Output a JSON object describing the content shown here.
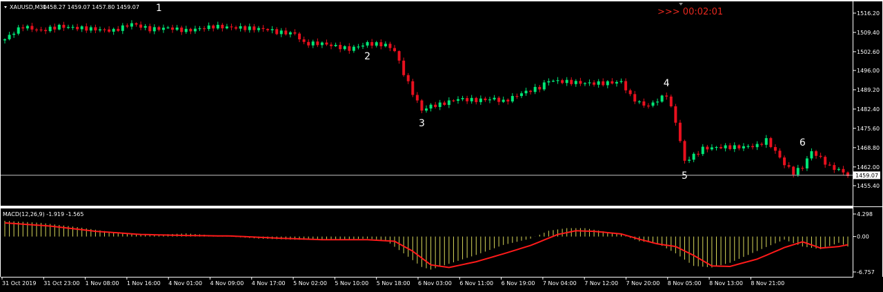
{
  "header": {
    "symbol": "XAUUSD,M30",
    "ohlc": "1458.27 1459.07 1457.80 1459.07",
    "timer": ">>> 00:02:01"
  },
  "price_axis": {
    "ticks": [
      "1516.20",
      "1509.40",
      "1502.60",
      "1496.00",
      "1489.20",
      "1482.40",
      "1475.60",
      "1468.80",
      "1462.00",
      "1455.40"
    ],
    "current_price": "1459.07"
  },
  "macd": {
    "label": "MACD(12,26,9) -1.919 -1.565",
    "ticks": [
      "4.298",
      "0.00",
      "-6.757"
    ]
  },
  "time_axis": {
    "labels": [
      "31 Oct 2019",
      "31 Oct 23:00",
      "1 Nov 08:00",
      "1 Nov 16:00",
      "4 Nov 01:00",
      "4 Nov 09:00",
      "4 Nov 17:00",
      "5 Nov 02:00",
      "5 Nov 10:00",
      "5 Nov 18:00",
      "6 Nov 03:00",
      "6 Nov 11:00",
      "6 Nov 19:00",
      "7 Nov 04:00",
      "7 Nov 12:00",
      "7 Nov 20:00",
      "8 Nov 05:00",
      "8 Nov 13:00",
      "8 Nov 21:00"
    ]
  },
  "annotations": [
    "1",
    "2",
    "3",
    "4",
    "5",
    "6"
  ],
  "colors": {
    "background": "#000000",
    "bull": "#00e676",
    "bear": "#e8101e",
    "text": "#ffffff",
    "macd_hist": "#d8d85a",
    "macd_signal": "#ff1a1a",
    "timer": "#e8281e",
    "grid_line": "#b0b0b0"
  },
  "chart_data": {
    "type": "candlestick",
    "symbol": "XAUUSD",
    "timeframe": "M30",
    "price_range": [
      1455.4,
      1516.2
    ],
    "price_path": [
      [
        0,
        1507.0
      ],
      [
        2,
        1509.5
      ],
      [
        4,
        1511.5
      ],
      [
        8,
        1510.0
      ],
      [
        12,
        1511.5
      ],
      [
        16,
        1511.0
      ],
      [
        20,
        1510.5
      ],
      [
        24,
        1510.0
      ],
      [
        28,
        1512.5
      ],
      [
        32,
        1510.5
      ],
      [
        36,
        1511.0
      ],
      [
        40,
        1510.0
      ],
      [
        46,
        1511.5
      ],
      [
        52,
        1511.0
      ],
      [
        58,
        1510.5
      ],
      [
        60,
        1509.5
      ],
      [
        64,
        1509.0
      ],
      [
        66,
        1505.5
      ],
      [
        70,
        1505.5
      ],
      [
        76,
        1503.5
      ],
      [
        80,
        1505.5
      ],
      [
        84,
        1505.0
      ],
      [
        86,
        1503.0
      ],
      [
        88,
        1495.0
      ],
      [
        90,
        1488.0
      ],
      [
        92,
        1482.0
      ],
      [
        94,
        1483.5
      ],
      [
        96,
        1484.0
      ],
      [
        100,
        1486.0
      ],
      [
        104,
        1485.5
      ],
      [
        108,
        1486.0
      ],
      [
        110,
        1485.0
      ],
      [
        112,
        1486.5
      ],
      [
        114,
        1488.0
      ],
      [
        116,
        1489.0
      ],
      [
        118,
        1490.0
      ],
      [
        120,
        1492.5
      ],
      [
        124,
        1492.0
      ],
      [
        128,
        1491.5
      ],
      [
        132,
        1491.5
      ],
      [
        136,
        1492.0
      ],
      [
        138,
        1487.0
      ],
      [
        140,
        1484.5
      ],
      [
        142,
        1483.5
      ],
      [
        144,
        1485.5
      ],
      [
        146,
        1487.5
      ],
      [
        148,
        1478.0
      ],
      [
        150,
        1464.0
      ],
      [
        152,
        1466.0
      ],
      [
        154,
        1468.5
      ],
      [
        158,
        1469.0
      ],
      [
        162,
        1469.0
      ],
      [
        166,
        1469.5
      ],
      [
        168,
        1471.5
      ],
      [
        170,
        1467.5
      ],
      [
        172,
        1463.0
      ],
      [
        174,
        1460.0
      ],
      [
        176,
        1462.0
      ],
      [
        178,
        1467.5
      ],
      [
        180,
        1465.0
      ],
      [
        182,
        1462.0
      ],
      [
        184,
        1461.0
      ],
      [
        186,
        1459.1
      ]
    ],
    "macd_path": [
      [
        0,
        3.0
      ],
      [
        8,
        2.6
      ],
      [
        16,
        1.8
      ],
      [
        24,
        0.8
      ],
      [
        32,
        0.3
      ],
      [
        40,
        0.6
      ],
      [
        48,
        0.1
      ],
      [
        56,
        -0.4
      ],
      [
        64,
        -0.6
      ],
      [
        72,
        -0.6
      ],
      [
        80,
        -0.4
      ],
      [
        84,
        -0.7
      ],
      [
        88,
        -3.2
      ],
      [
        92,
        -5.8
      ],
      [
        94,
        -6.3
      ],
      [
        98,
        -5.2
      ],
      [
        104,
        -3.5
      ],
      [
        110,
        -1.6
      ],
      [
        116,
        -0.4
      ],
      [
        120,
        1.1
      ],
      [
        124,
        1.6
      ],
      [
        128,
        1.6
      ],
      [
        132,
        1.0
      ],
      [
        136,
        0.4
      ],
      [
        140,
        -0.9
      ],
      [
        144,
        -1.3
      ],
      [
        148,
        -3.2
      ],
      [
        152,
        -5.6
      ],
      [
        156,
        -5.9
      ],
      [
        160,
        -5.0
      ],
      [
        164,
        -3.5
      ],
      [
        168,
        -2.0
      ],
      [
        172,
        -0.6
      ],
      [
        176,
        -1.9
      ],
      [
        180,
        -2.4
      ],
      [
        184,
        -1.2
      ],
      [
        186,
        -1.9
      ]
    ],
    "signal_path": [
      [
        0,
        2.6
      ],
      [
        10,
        2.0
      ],
      [
        20,
        1.0
      ],
      [
        30,
        0.4
      ],
      [
        40,
        0.2
      ],
      [
        50,
        0.1
      ],
      [
        60,
        -0.3
      ],
      [
        70,
        -0.6
      ],
      [
        80,
        -0.6
      ],
      [
        86,
        -0.9
      ],
      [
        90,
        -2.8
      ],
      [
        94,
        -5.4
      ],
      [
        98,
        -5.9
      ],
      [
        104,
        -4.8
      ],
      [
        110,
        -3.3
      ],
      [
        116,
        -1.7
      ],
      [
        122,
        0.4
      ],
      [
        126,
        1.1
      ],
      [
        130,
        1.0
      ],
      [
        136,
        0.5
      ],
      [
        140,
        -0.5
      ],
      [
        144,
        -1.4
      ],
      [
        148,
        -1.9
      ],
      [
        152,
        -3.6
      ],
      [
        156,
        -5.6
      ],
      [
        160,
        -5.7
      ],
      [
        166,
        -4.3
      ],
      [
        172,
        -2.1
      ],
      [
        176,
        -1.0
      ],
      [
        180,
        -2.2
      ],
      [
        184,
        -1.9
      ],
      [
        186,
        -1.565
      ]
    ],
    "macd_range": [
      -6.757,
      4.298
    ],
    "wave_points": [
      {
        "label": "1",
        "bar": 34,
        "price": 1515.5,
        "pos": "above"
      },
      {
        "label": "2",
        "bar": 80,
        "price": 1504.0,
        "pos": "below"
      },
      {
        "label": "3",
        "bar": 92,
        "price": 1480.5,
        "pos": "below"
      },
      {
        "label": "4",
        "bar": 146,
        "price": 1489.0,
        "pos": "above"
      },
      {
        "label": "5",
        "bar": 150,
        "price": 1462.0,
        "pos": "below"
      },
      {
        "label": "6",
        "bar": 176,
        "price": 1468.0,
        "pos": "above"
      }
    ]
  }
}
